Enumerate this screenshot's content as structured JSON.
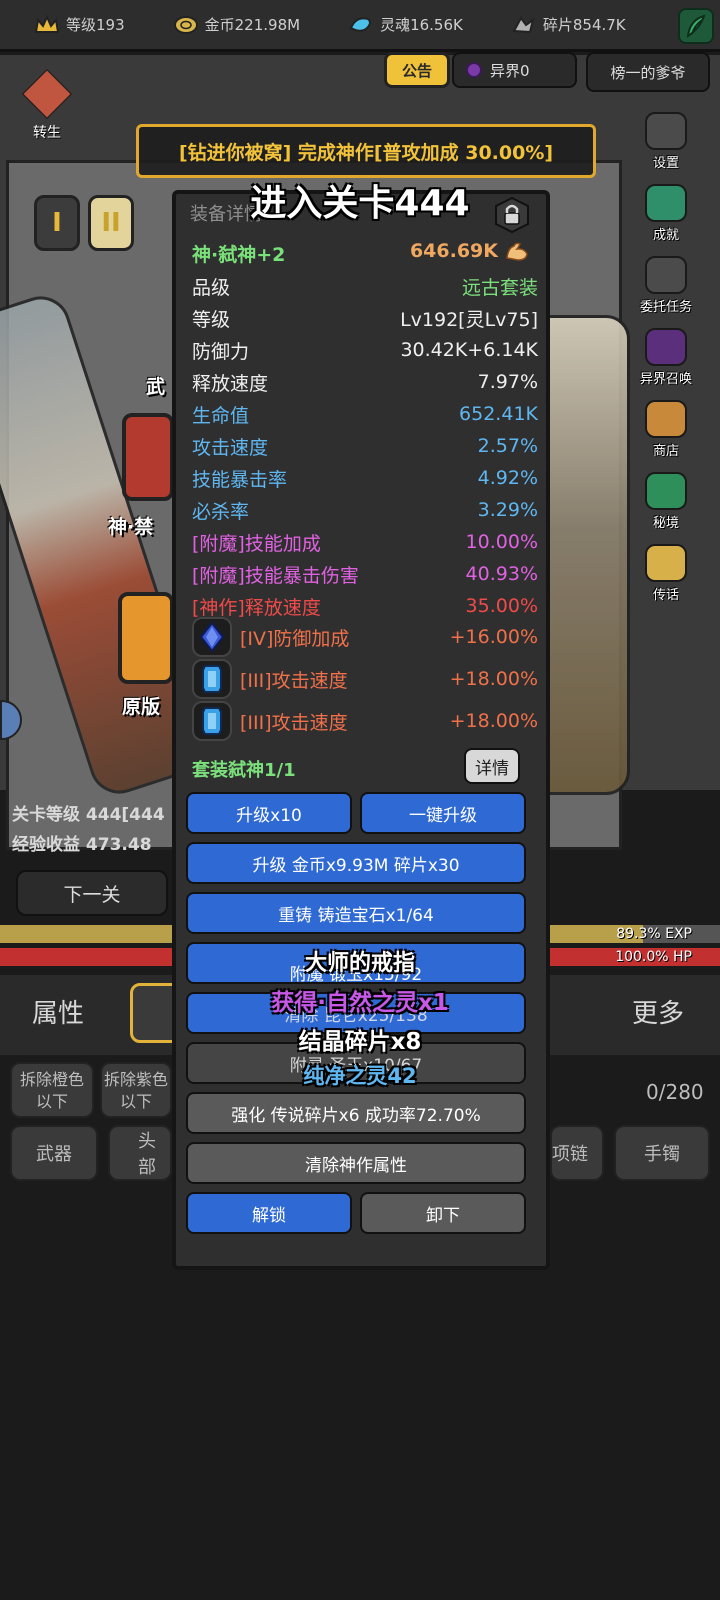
{
  "resources": [
    {
      "icon": "crown-icon",
      "label": "等级193"
    },
    {
      "icon": "coin-icon",
      "label": "金币221.98M"
    },
    {
      "icon": "soul-icon",
      "label": "灵魂16.56K"
    },
    {
      "icon": "fragment-icon",
      "label": "碎片854.7K"
    }
  ],
  "header": {
    "notice": "公告",
    "realm": "异界0",
    "rank": "榜一的爹爷",
    "rebirth": "转生"
  },
  "side_menu": [
    "设置",
    "成就",
    "委托任务",
    "异界召唤",
    "商店",
    "秘境",
    "传话"
  ],
  "tiers": [
    "I",
    "II"
  ],
  "background_labels": {
    "weapon_short": "武",
    "equipped_name": "神·禁",
    "original": "原版"
  },
  "stage_info": {
    "level": "关卡等级 444[444",
    "exp": "经验收益 473.48",
    "next": "下一关"
  },
  "bars": {
    "exp": "89.3% EXP",
    "hp": "100.0%  HP"
  },
  "bottom_tabs": {
    "attr": "属性",
    "more": "更多"
  },
  "filters": [
    {
      "line1": "拆除橙色",
      "line2": "以下"
    },
    {
      "line1": "拆除紫色",
      "line2": "以下"
    }
  ],
  "inventory_count": "0/280",
  "categories": [
    "武器",
    "头部",
    "项链",
    "手镯"
  ],
  "modal": {
    "title": "装备详情",
    "item_name": "神·弑神+2",
    "power": "646.69K",
    "stats": [
      {
        "label": "品级",
        "value": "远古套装",
        "lc": "white",
        "vc": "green"
      },
      {
        "label": "等级",
        "value": "Lv192[灵Lv75]",
        "lc": "white",
        "vc": "white"
      },
      {
        "label": "防御力",
        "value": "30.42K+6.14K",
        "lc": "white",
        "vc": "white"
      },
      {
        "label": "释放速度",
        "value": "7.97%",
        "lc": "white",
        "vc": "white"
      },
      {
        "label": "生命值",
        "value": "652.41K",
        "lc": "blue",
        "vc": "blue"
      },
      {
        "label": "攻击速度",
        "value": "2.57%",
        "lc": "blue",
        "vc": "blue"
      },
      {
        "label": "技能暴击率",
        "value": "4.92%",
        "lc": "blue",
        "vc": "blue"
      },
      {
        "label": "必杀率",
        "value": "3.29%",
        "lc": "blue",
        "vc": "blue"
      },
      {
        "label": "[附魔]技能加成",
        "value": "10.00%",
        "lc": "pink",
        "vc": "pink"
      },
      {
        "label": "[附魔]技能暴击伤害",
        "value": "40.93%",
        "lc": "pink",
        "vc": "pink"
      },
      {
        "label": "[神作]释放速度",
        "value": "35.00%",
        "lc": "red",
        "vc": "red"
      }
    ],
    "gems": [
      {
        "icon": "sapphire-gem-icon",
        "label": "[IV]防御加成",
        "value": "+16.00%"
      },
      {
        "icon": "crystal-gem-icon",
        "label": "[III]攻击速度",
        "value": "+18.00%"
      },
      {
        "icon": "crystal-gem-icon",
        "label": "[III]攻击速度",
        "value": "+18.00%"
      }
    ],
    "set_label": "套装弑神1/1",
    "detail_btn": "详情",
    "buttons": {
      "upgrade10": "升级x10",
      "one_click": "一键升级",
      "upgrade_cost": "升级 金币x9.93M 碎片x30",
      "reforge": "重铸 铸造宝石x1/64",
      "enchant": "附魔 锻玉x15/92",
      "purify": "清除 昆仑x25/138",
      "attach": "附灵 圣玉x10/67",
      "strengthen": "强化 传说碎片x6 成功率72.70%",
      "clear_god": "清除神作属性",
      "unlock": "解锁",
      "unequip": "卸下"
    }
  },
  "overlays": {
    "banner": "[钻进你被窝] 完成神作[普攻加成 30.00%]",
    "enter_stage": "进入关卡444",
    "drop_name": "大师的戒指",
    "gain": "获得·自然之灵x1",
    "crystal": "结晶碎片x8",
    "pure_soul": "纯净之灵42"
  },
  "colors": {
    "accent_blue_button": "#2f6ad4",
    "set_green": "#7be07c",
    "stat_blue": "#5fb7f2",
    "enchant_pink": "#e062e2",
    "god_red": "#f04a4a",
    "gem_orange": "#f0704a",
    "banner_gold": "#f2c23a"
  }
}
